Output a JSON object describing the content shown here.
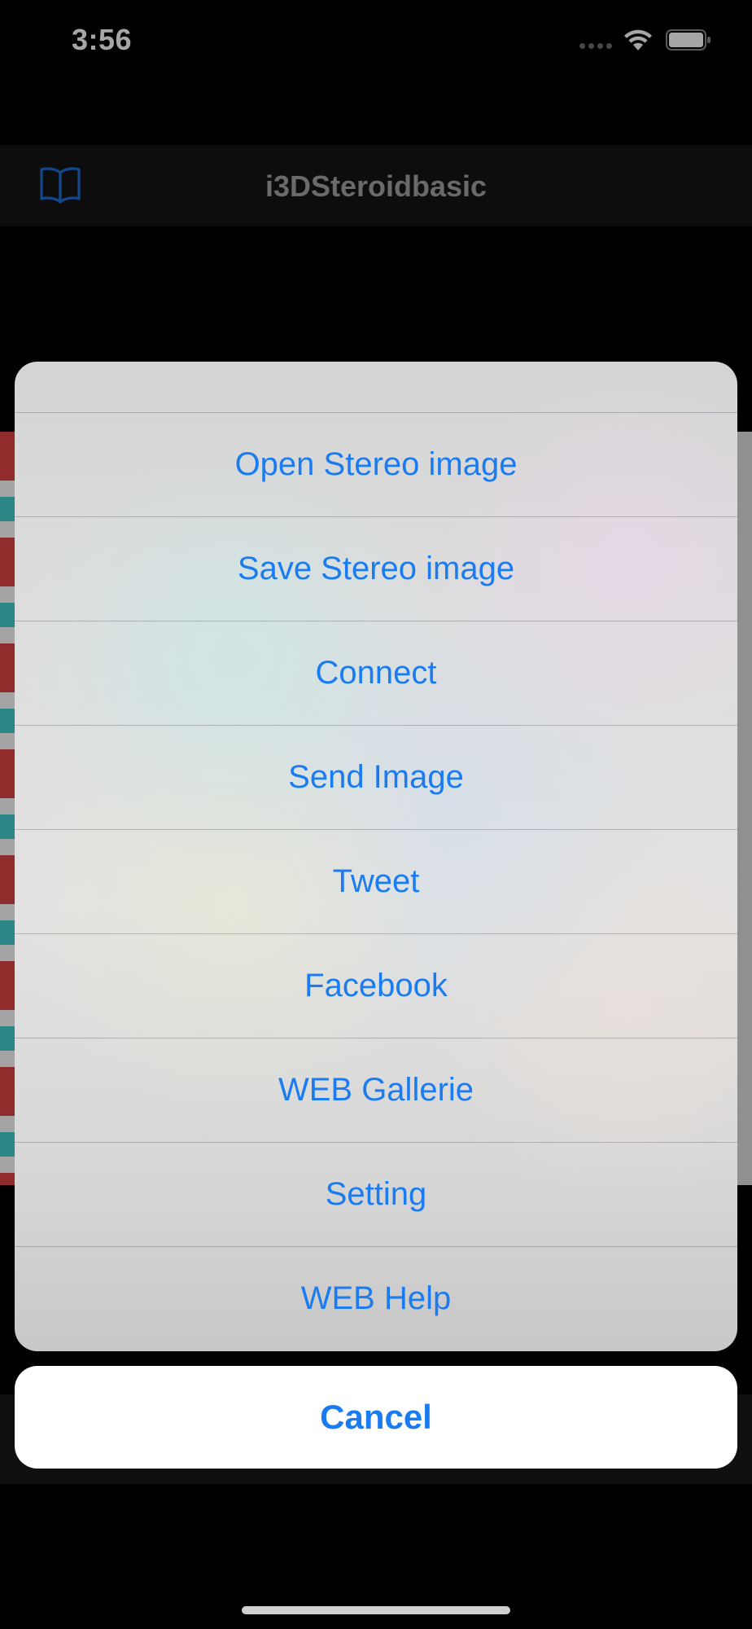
{
  "status_bar": {
    "time": "3:56"
  },
  "nav": {
    "title": "i3DSteroidbasic",
    "left_icon": "book-icon"
  },
  "action_sheet": {
    "items": [
      {
        "label": "Open Stereo image"
      },
      {
        "label": "Save Stereo image"
      },
      {
        "label": "Connect"
      },
      {
        "label": "Send Image"
      },
      {
        "label": "Tweet"
      },
      {
        "label": "Facebook"
      },
      {
        "label": "WEB Gallerie"
      },
      {
        "label": "Setting"
      },
      {
        "label": "WEB Help"
      }
    ],
    "cancel_label": "Cancel"
  },
  "colors": {
    "accent": "#1a7cf0",
    "background": "#000000",
    "nav_bar": "#141414"
  }
}
